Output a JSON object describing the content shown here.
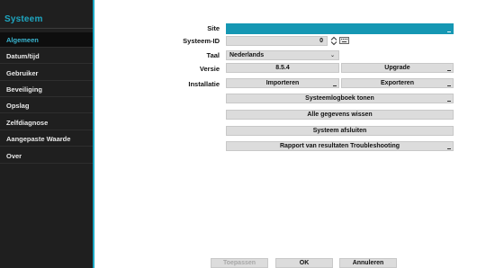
{
  "sidebar": {
    "title": "Systeem",
    "items": [
      {
        "label": "Algemeen",
        "active": true
      },
      {
        "label": "Datum/tijd"
      },
      {
        "label": "Gebruiker"
      },
      {
        "label": "Beveiliging"
      },
      {
        "label": "Opslag"
      },
      {
        "label": "Zelfdiagnose"
      },
      {
        "label": "Aangepaste Waarde"
      },
      {
        "label": "Over"
      }
    ]
  },
  "form": {
    "site_label": "Site",
    "site_value": "",
    "system_id_label": "Systeem-ID",
    "system_id_value": "0",
    "language_label": "Taal",
    "language_value": "Nederlands",
    "version_label": "Versie",
    "version_value": "8.5.4",
    "upgrade_label": "Upgrade",
    "installation_label": "Installatie",
    "import_label": "Importeren",
    "export_label": "Exporteren",
    "show_syslog_label": "Systeemlogboek tonen",
    "clear_data_label": "Alle gegevens wissen",
    "shutdown_label": "Systeem afsluiten",
    "troubleshoot_label": "Rapport van resultaten Troubleshooting"
  },
  "footer": {
    "apply_label": "Toepassen",
    "ok_label": "OK",
    "cancel_label": "Annuleren"
  },
  "colors": {
    "accent": "#1ea7c2",
    "site_field": "#1597b3",
    "sidebar_bg": "#1f1f1f"
  }
}
